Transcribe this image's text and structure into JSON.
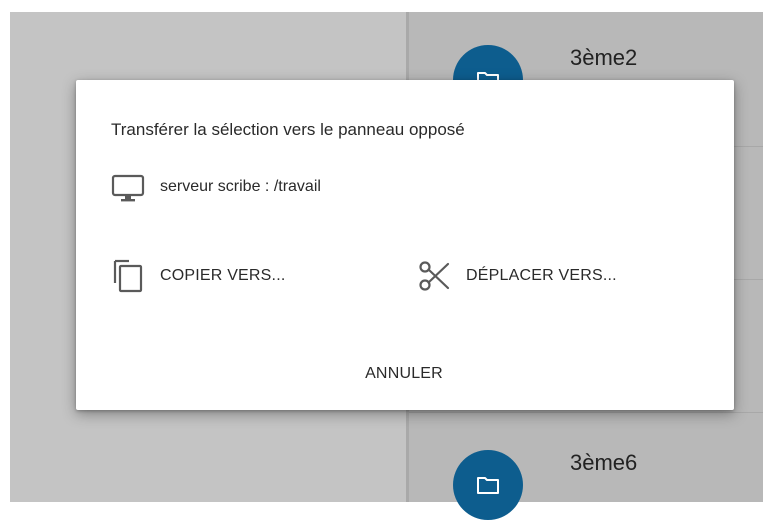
{
  "background": {
    "folders": [
      {
        "name": "3ème2",
        "icon": "folder-icon"
      },
      {
        "name": "3ème6",
        "icon": "folder-icon"
      }
    ],
    "folder_color": "#0d5d8e"
  },
  "dialog": {
    "title": "Transférer la sélection vers le panneau opposé",
    "destination": {
      "icon": "monitor-icon",
      "label": "serveur scribe : /travail"
    },
    "copy": {
      "icon": "copy-icon",
      "label": "COPIER VERS..."
    },
    "move": {
      "icon": "scissors-icon",
      "label": "DÉPLACER VERS..."
    },
    "cancel_label": "ANNULER"
  }
}
